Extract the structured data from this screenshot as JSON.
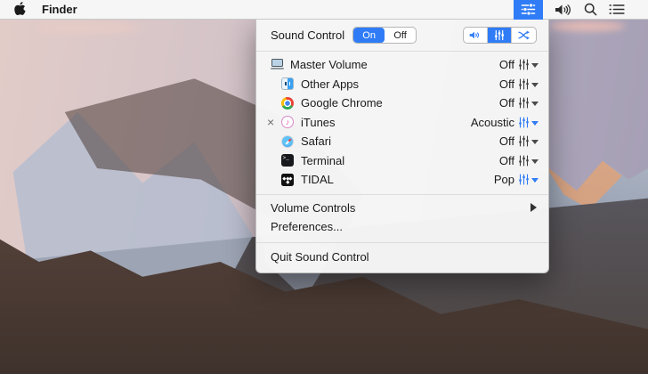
{
  "menu_bar": {
    "app_name": "Finder"
  },
  "panel": {
    "title": "Sound Control",
    "power_toggle": {
      "options": [
        "On",
        "Off"
      ],
      "selected": "On"
    },
    "apps": [
      {
        "name": "Master Volume",
        "preset": "Off",
        "active": false
      },
      {
        "name": "Other Apps",
        "preset": "Off",
        "active": false
      },
      {
        "name": "Google Chrome",
        "preset": "Off",
        "active": false
      },
      {
        "name": "iTunes",
        "preset": "Acoustic",
        "active": true,
        "remove_label": "×"
      },
      {
        "name": "Safari",
        "preset": "Off",
        "active": false
      },
      {
        "name": "Terminal",
        "preset": "Off",
        "active": false
      },
      {
        "name": "TIDAL",
        "preset": "Pop",
        "active": true
      }
    ],
    "menu_items": [
      {
        "label": "Volume Controls",
        "has_submenu": true
      },
      {
        "label": "Preferences..."
      },
      {
        "label": "Quit Sound Control"
      }
    ]
  },
  "colors": {
    "accent": "#2f7cf6",
    "menu_bg": "#f6f6f6"
  }
}
